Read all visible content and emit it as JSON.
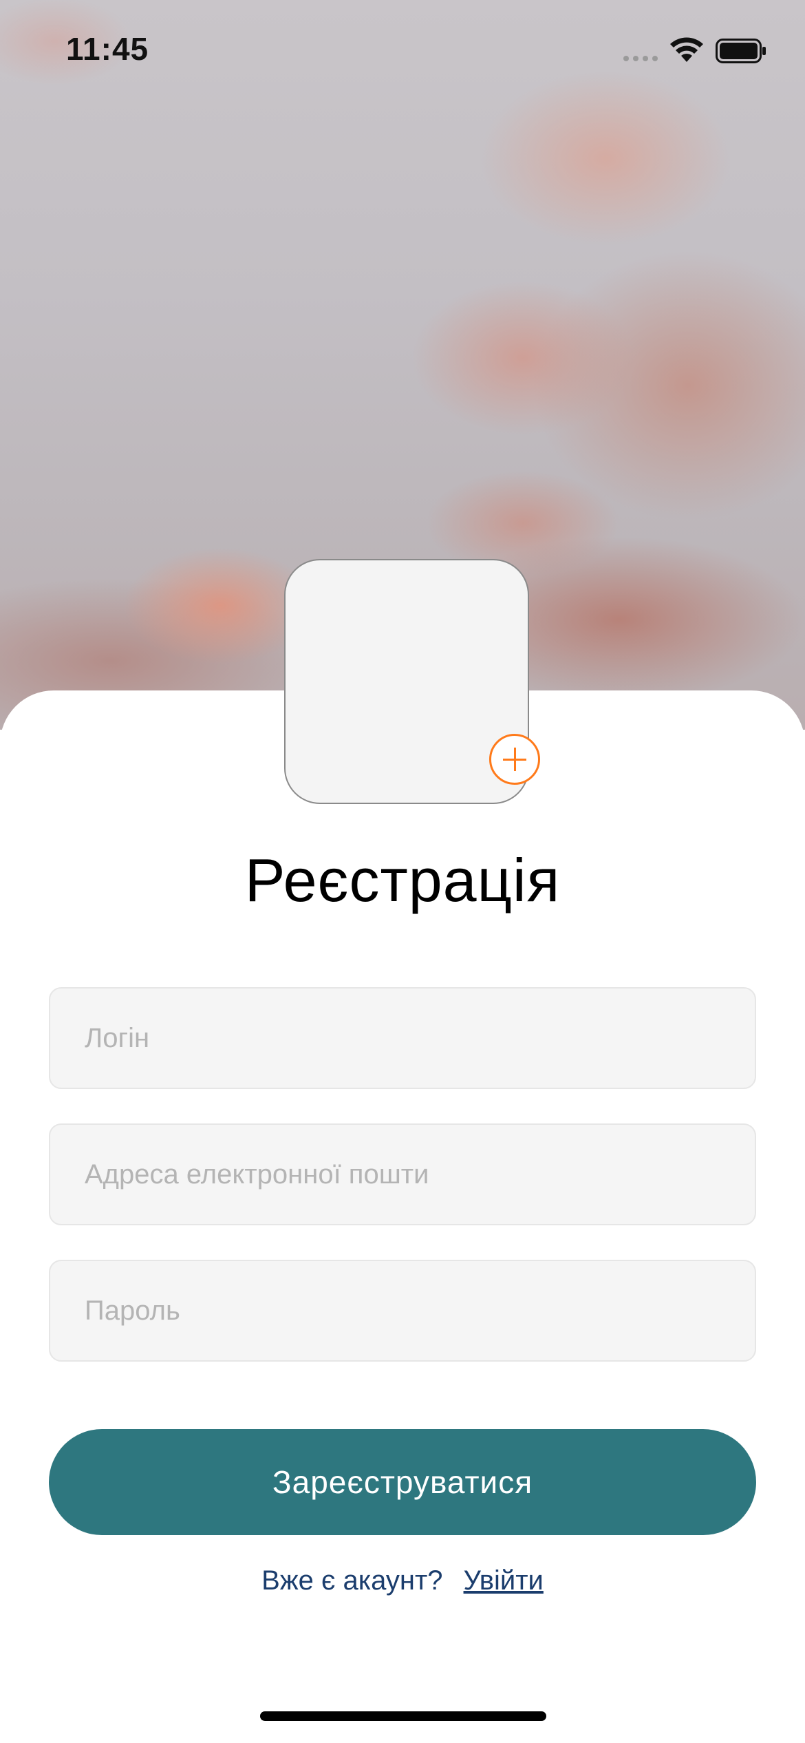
{
  "status_bar": {
    "time": "11:45",
    "signal_icon": "cellular-signal-icon",
    "wifi_icon": "wifi-icon",
    "battery_icon": "battery-full-icon"
  },
  "background": {
    "description_icon": "sky-clouds-image"
  },
  "avatar": {
    "add_icon": "plus-circle-icon",
    "accent_color": "#ff7a1a"
  },
  "title": "Реєстрація",
  "form": {
    "login_placeholder": "Логін",
    "email_placeholder": "Адреса електронної пошти",
    "password_placeholder": "Пароль",
    "login_value": "",
    "email_value": "",
    "password_value": ""
  },
  "register_button": {
    "label": "Зареєструватися",
    "color": "#2e777f"
  },
  "login_prompt": {
    "text": "Вже є акаунт?",
    "link_label": "Увійти",
    "color": "#1b3d6d"
  }
}
